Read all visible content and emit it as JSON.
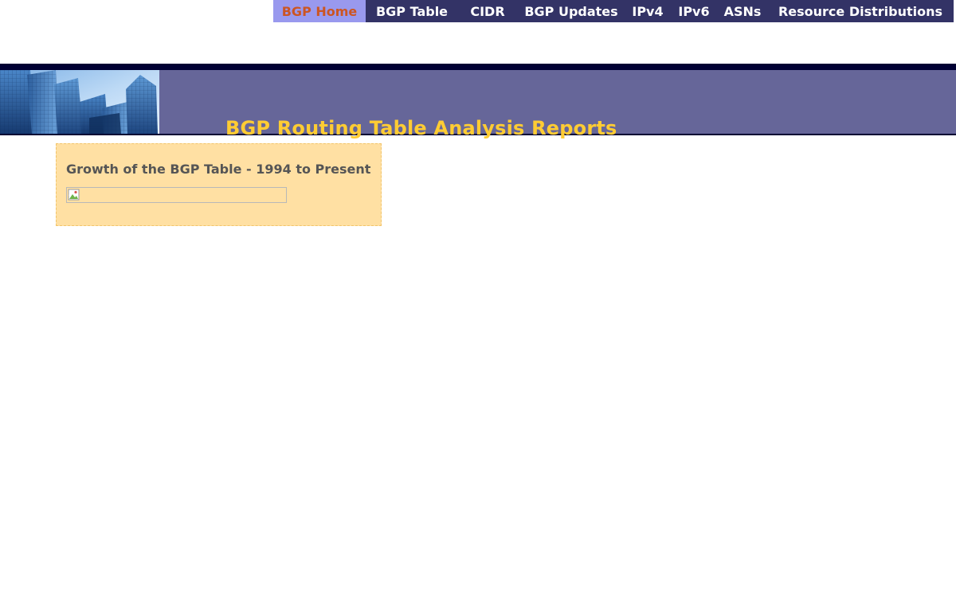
{
  "nav": {
    "items": [
      {
        "label": "BGP Home",
        "active": true
      },
      {
        "label": "BGP Table",
        "active": false
      },
      {
        "label": "CIDR",
        "active": false
      },
      {
        "label": "BGP Updates",
        "active": false
      },
      {
        "label": "IPv4",
        "active": false
      },
      {
        "label": "IPv6",
        "active": false
      },
      {
        "label": "ASNs",
        "active": false
      },
      {
        "label": "Resource Distributions",
        "active": false
      }
    ]
  },
  "banner": {
    "title": "BGP Routing Table Analysis Reports",
    "image_icon": "city-buildings-photo"
  },
  "content": {
    "heading": "Growth of the BGP Table - 1994 to Present",
    "image_icon": "broken-image-icon"
  },
  "colors": {
    "nav_bg": "#333366",
    "nav_active_bg": "#9999ee",
    "nav_active_text": "#cc5522",
    "banner_bg": "#666699",
    "banner_rule": "#000033",
    "title_color": "#ffcc33",
    "box_bg": "#ffe0a3",
    "box_border": "#f2c46a"
  }
}
